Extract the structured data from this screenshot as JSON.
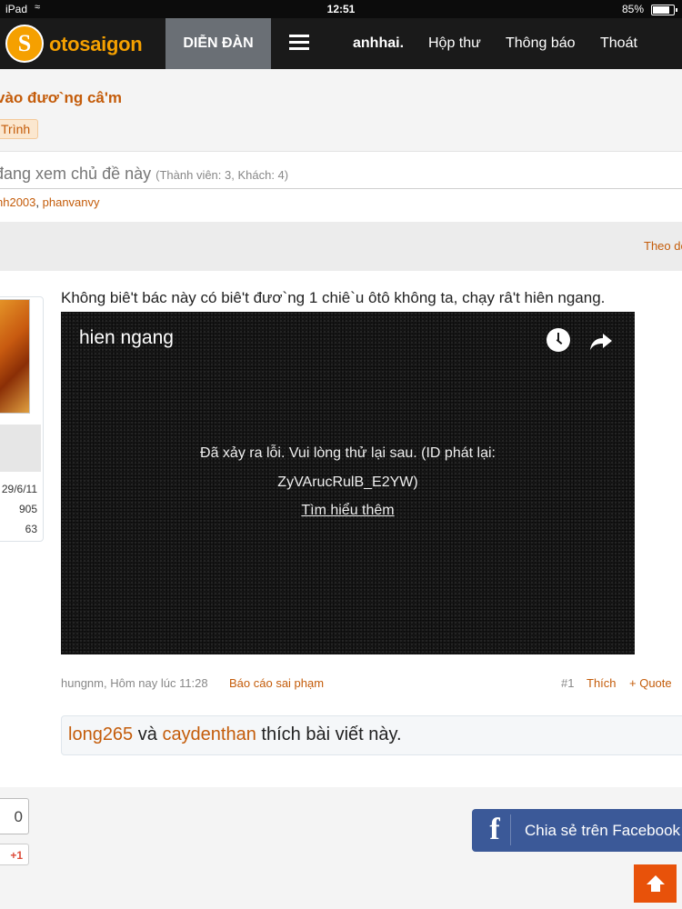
{
  "status": {
    "device": "iPad",
    "time": "12:51",
    "battery": "85%"
  },
  "nav": {
    "logo_mark": "S",
    "logo_text": "otosaigon",
    "forum_tab": "DIỄN ĐÀN",
    "user": "anhhai.",
    "inbox": "Hộp thư",
    "alerts": "Thông báo",
    "logout": "Thoát"
  },
  "thread": {
    "title": "vào đươ`ng câ'm",
    "tag": "Trình"
  },
  "viewers": {
    "heading": "đang xem chủ đề này",
    "counts": "(Thành viên: 3, Khách: 4)",
    "names": [
      "nh2003",
      "phanvanvy"
    ],
    "separator": ", "
  },
  "follow_label": "Theo dõi",
  "post": {
    "join_date": "29/6/11",
    "stat_messages": "905",
    "stat_likes": "63",
    "message": "Không biê't bác này có biê't đươ`ng 1 chiê`u ôtô không ta, chạy râ't hiên ngang.",
    "video": {
      "title": "hien ngang",
      "error_line1": "Đã xảy ra lỗi. Vui lòng thử lại sau. (ID phát lại:",
      "error_line2": "ZyVArucRulB_E2YW)",
      "learn_more": "Tìm hiểu thêm"
    },
    "meta": {
      "author_time": "hungnm, Hôm nay lúc 11:28",
      "report": "Báo cáo sai phạm",
      "number": "#1",
      "like": "Thích",
      "quote": "+ Quote"
    },
    "likes": {
      "user1": "long265",
      "conj": " và ",
      "user2": "caydenthan",
      "suffix": " thích bài viết này."
    }
  },
  "social": {
    "share_count": "0",
    "gplus": "+1",
    "fb_letter": "f",
    "fb_label": "Chia sẻ trên Facebook"
  },
  "colors": {
    "accent": "#c45c0a",
    "nav_bg": "#1a1a1a",
    "facebook": "#3b5998",
    "to_top": "#e8520a"
  },
  "icons": [
    "wifi-icon",
    "battery-icon",
    "menu-icon",
    "clock-icon",
    "share-icon",
    "facebook-icon",
    "arrow-up-icon"
  ]
}
